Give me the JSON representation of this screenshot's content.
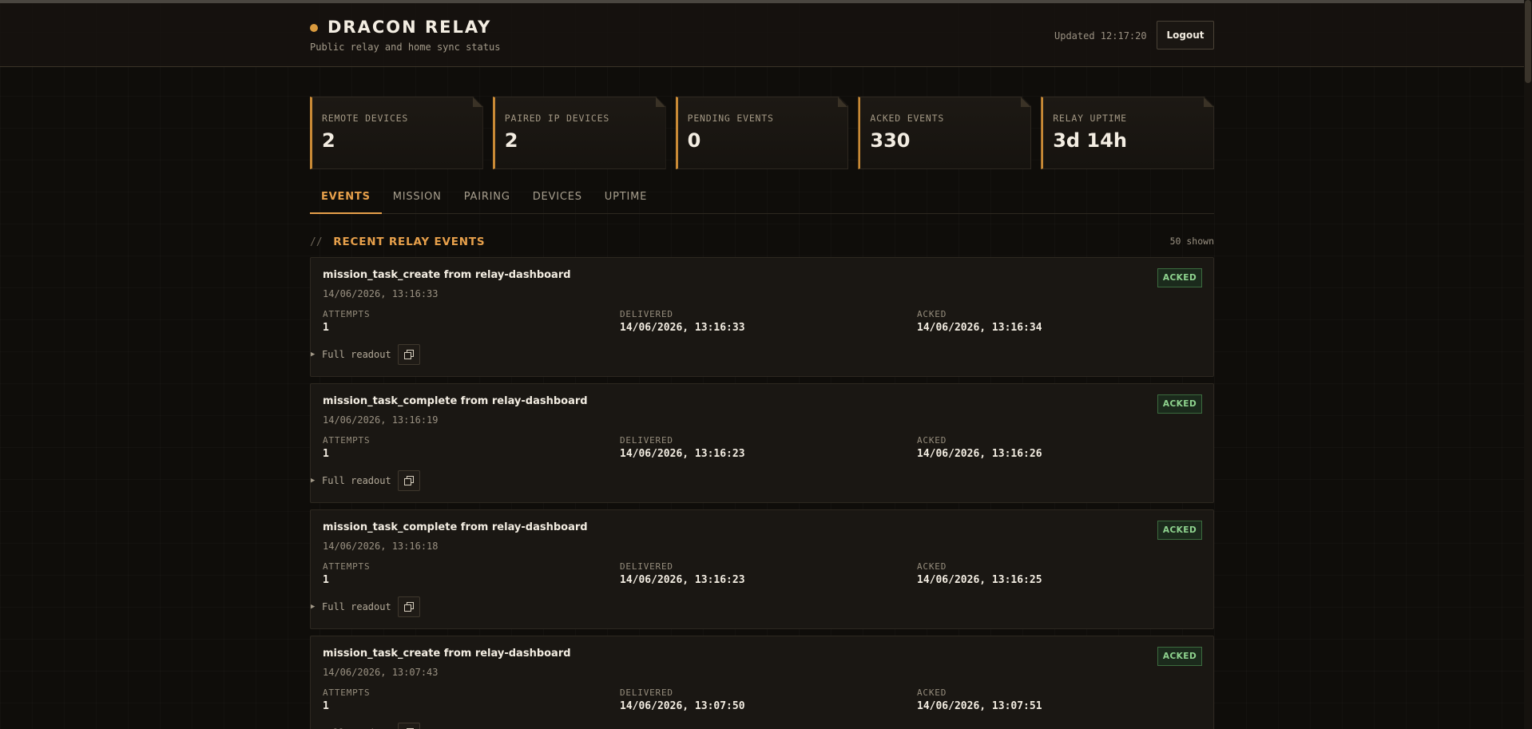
{
  "header": {
    "title": "DRACON RELAY",
    "subtitle": "Public relay and home sync status",
    "updated": "Updated 12:17:20",
    "logout_label": "Logout"
  },
  "stats": [
    {
      "label": "REMOTE DEVICES",
      "value": "2"
    },
    {
      "label": "PAIRED IP DEVICES",
      "value": "2"
    },
    {
      "label": "PENDING EVENTS",
      "value": "0"
    },
    {
      "label": "ACKED EVENTS",
      "value": "330"
    },
    {
      "label": "RELAY UPTIME",
      "value": "3d 14h"
    }
  ],
  "tabs": [
    {
      "label": "EVENTS",
      "active": true
    },
    {
      "label": "MISSION",
      "active": false
    },
    {
      "label": "PAIRING",
      "active": false
    },
    {
      "label": "DEVICES",
      "active": false
    },
    {
      "label": "UPTIME",
      "active": false
    }
  ],
  "section": {
    "prefix": "//",
    "title": "RECENT RELAY EVENTS",
    "shown": "50 shown"
  },
  "labels": {
    "attempts": "ATTEMPTS",
    "delivered": "DELIVERED",
    "acked": "ACKED",
    "readout": "Full readout"
  },
  "events": [
    {
      "title": "mission_task_create from relay-dashboard",
      "time": "14/06/2026, 13:16:33",
      "status": "ACKED",
      "attempts": "1",
      "delivered": "14/06/2026, 13:16:33",
      "acked": "14/06/2026, 13:16:34"
    },
    {
      "title": "mission_task_complete from relay-dashboard",
      "time": "14/06/2026, 13:16:19",
      "status": "ACKED",
      "attempts": "1",
      "delivered": "14/06/2026, 13:16:23",
      "acked": "14/06/2026, 13:16:26"
    },
    {
      "title": "mission_task_complete from relay-dashboard",
      "time": "14/06/2026, 13:16:18",
      "status": "ACKED",
      "attempts": "1",
      "delivered": "14/06/2026, 13:16:23",
      "acked": "14/06/2026, 13:16:25"
    },
    {
      "title": "mission_task_create from relay-dashboard",
      "time": "14/06/2026, 13:07:43",
      "status": "ACKED",
      "attempts": "1",
      "delivered": "14/06/2026, 13:07:50",
      "acked": "14/06/2026, 13:07:51"
    }
  ],
  "colors": {
    "accent": "#e7a04b",
    "background": "#0f0d0a",
    "acked_badge": "#8fd48f"
  },
  "icons": {
    "brand": "status-dot-icon",
    "readout_toggle": "caret-right-icon",
    "copy": "copy-icon"
  }
}
